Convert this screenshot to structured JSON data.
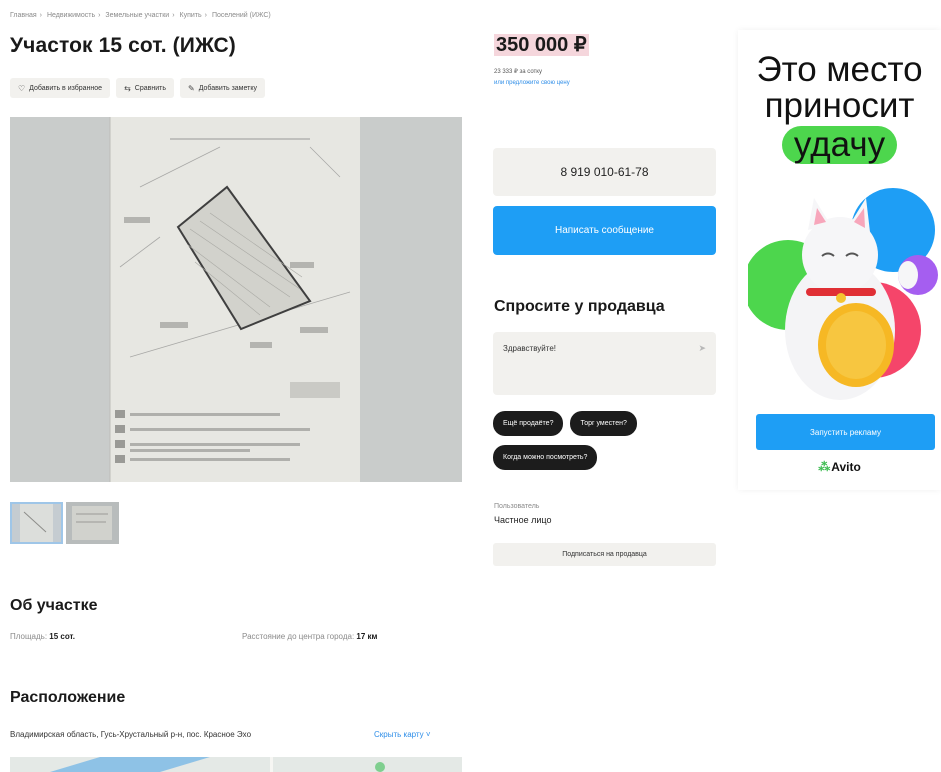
{
  "breadcrumb": [
    "Главная",
    "Недвижимость",
    "Земельные участки",
    "Купить",
    "Поселений (ИЖС)"
  ],
  "listing": {
    "title": "Участок 15 сот. (ИЖС)",
    "actions": [
      {
        "icon": "heart-icon",
        "label": "Добавить в избранное"
      },
      {
        "icon": "compare-icon",
        "label": "Сравнить"
      },
      {
        "icon": "note-icon",
        "label": "Добавить заметку"
      }
    ]
  },
  "about": {
    "heading": "Об участке",
    "params": [
      {
        "label": "Площадь:",
        "value": "15 сот."
      },
      {
        "label": "Расстояние до центра города:",
        "value": "17 км"
      }
    ]
  },
  "location": {
    "heading": "Расположение",
    "address": "Владимирская область, Гусь-Хрустальный р-н, пос. Красное Эхо",
    "map_link": "Скрыть карту"
  },
  "sidebar": {
    "price": "350 000 ₽",
    "price_per_unit": "23 333 ₽ за сотку",
    "offer_link": "или предложите свою цену",
    "phone": "8 919 010-61-78",
    "message_button": "Написать сообщение",
    "ask_heading": "Спросите у продавца",
    "ask_text": "Здравствуйте!",
    "chips": [
      "Ещё продаёте?",
      "Торг уместен?",
      "Когда можно посмотреть?"
    ],
    "seller_type": "Пользователь",
    "seller_name": "Частное лицо",
    "subscribe_button": "Подписаться на продавца"
  },
  "ad": {
    "line1": "Это место",
    "line2": "приносит",
    "line3": "удачу",
    "button": "Запустить рекламу",
    "logo": "Avito"
  },
  "colors": {
    "accent_blue": "#1e9ef5",
    "price_highlight": "#f5d6dc",
    "ad_green": "#4dd64d"
  }
}
